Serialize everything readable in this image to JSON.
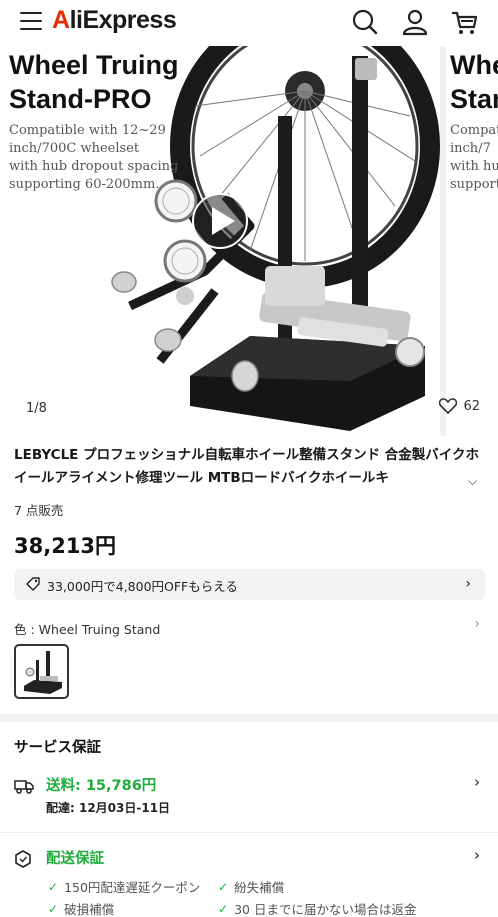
{
  "header": {
    "logo_prefix": "A",
    "logo_rest": "liExpress",
    "icons": [
      "menu-icon",
      "search-icon",
      "account-icon",
      "cart-icon"
    ]
  },
  "gallery": {
    "slide1": {
      "title_line1": "Wheel Truing",
      "title_line2": "Stand-PRO",
      "desc_line1": "Compatible with 12~29",
      "desc_line2": "inch/700C wheelset",
      "desc_line3": "with hub dropout spacing",
      "desc_line4": "supporting 60-200mm."
    },
    "slide2": {
      "title_line1": "Whe",
      "title_line2": "Stan",
      "desc_line1": "Compat",
      "desc_line2": "inch/7",
      "desc_line3": "with hu",
      "desc_line4": "support"
    },
    "counter": "1/8",
    "likes": "62"
  },
  "product": {
    "title": "LEBYCLE プロフェッショナル自転車ホイール整備スタンド 合金製バイクホイールアライメント修理ツール MTBロードバイクホイールキ",
    "sold": "7 点販売",
    "price": "38,213円",
    "coupon": "33,000円で4,800円OFFもらえる",
    "color_label": "色 : Wheel Truing Stand"
  },
  "service": {
    "title": "サービス保証",
    "shipping_label": "送料: 15,786円",
    "delivery": "配達: 12月03日-11日",
    "guarantee_label": "配送保証",
    "items": [
      "150円配達遅延クーポン",
      "紛失補償",
      "破損補償",
      "30 日までに届かない場合は返金"
    ]
  },
  "colors": {
    "accent_green": "#1eae3b",
    "logo_red": "#e62e04"
  }
}
